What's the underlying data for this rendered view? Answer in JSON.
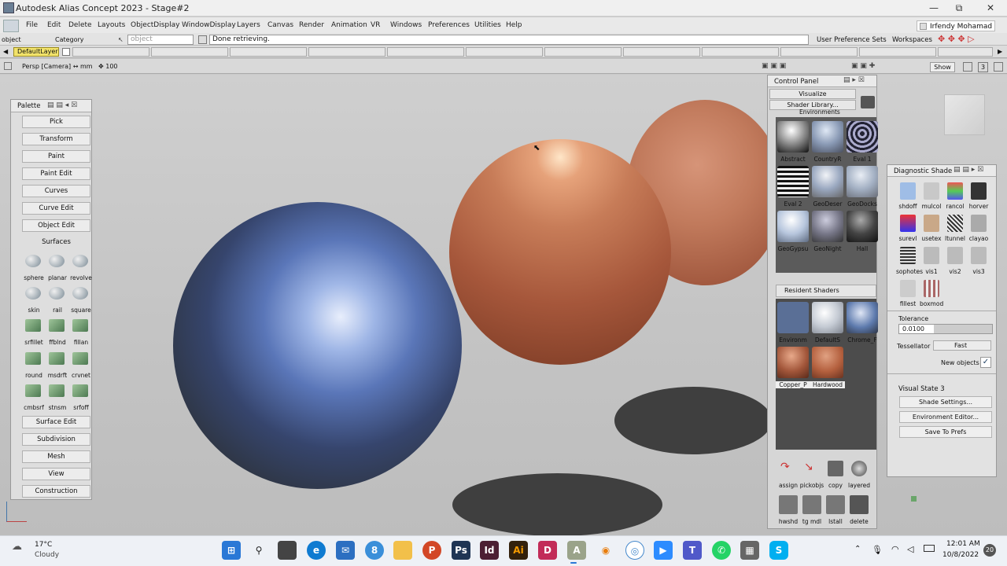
{
  "window": {
    "title": "Autodesk Alias Concept 2023 - Stage#2",
    "minimize": "—",
    "maximize": "⧉",
    "close": "✕"
  },
  "menu": [
    "File",
    "Edit",
    "Delete",
    "Layouts",
    "ObjectDisplay",
    "WindowDisplay",
    "Layers",
    "Canvas",
    "Render",
    "Animation",
    "VR",
    "Windows",
    "Preferences",
    "Utilities",
    "Help"
  ],
  "user": "Irfendy Mohamad",
  "toolrow": {
    "mode": "object",
    "category": "Category",
    "object_placeholder": "object",
    "status": "Done retrieving.",
    "user_pref": "User Preference Sets",
    "workspaces": "Workspaces"
  },
  "layer": {
    "default": "DefaultLayer"
  },
  "viewstrip": {
    "camera": "Persp [Camera] ↔ mm",
    "zoom": "✥ 100",
    "show": "Show",
    "count": "3"
  },
  "palette": {
    "title": "Palette",
    "buttons_top": [
      "Pick",
      "Transform",
      "Paint",
      "Paint Edit",
      "Curves",
      "Curve Edit",
      "Object Edit"
    ],
    "surfaces_label": "Surfaces",
    "tools": [
      "sphere",
      "planar",
      "revolve",
      "skin",
      "rail",
      "square",
      "srfillet",
      "ffblnd",
      "fillan",
      "round",
      "msdrft",
      "crvnet",
      "cmbsrf",
      "stnsm",
      "srfoff"
    ],
    "buttons_bottom": [
      "Surface Edit",
      "Subdivision",
      "Mesh",
      "View",
      "Construction"
    ]
  },
  "control_panel": {
    "title": "Control Panel",
    "visualize": "Visualize",
    "shader_library": "Shader Library...",
    "environments_label": "Environments",
    "environments": [
      "Abstract",
      "CountryR",
      "Eval 1",
      "Eval 2",
      "GeoDeser",
      "GeoDocks",
      "GeoGypsu",
      "GeoNight",
      "Hall"
    ],
    "resident_label": "Resident Shaders",
    "resident": [
      "Environm",
      "DefaultS",
      "Chrome_F",
      "Copper_P",
      "Hardwood"
    ],
    "tools1": [
      "assign",
      "pickobjs",
      "copy",
      "layered"
    ],
    "tools2": [
      "hwshd",
      "tg mdl",
      "lstall",
      "delete"
    ]
  },
  "diagnostic": {
    "title": "Diagnostic Shade",
    "icons": [
      "shdoff",
      "mulcol",
      "rancol",
      "horver",
      "surevl",
      "usetex",
      "ltunnel",
      "clayao",
      "sophotes",
      "vis1",
      "vis2",
      "vis3",
      "fillest",
      "boxmod"
    ],
    "tolerance_label": "Tolerance",
    "tolerance_value": "0.0100",
    "tessellator_label": "Tessellator",
    "tessellator_value": "Fast",
    "new_objects": "New objects",
    "new_objects_checked": "✓",
    "visual_state": "Visual State 3",
    "buttons": [
      "Shade Settings...",
      "Environment Editor...",
      "Save To Prefs"
    ]
  },
  "taskbar": {
    "temp": "17°C",
    "weather": "Cloudy",
    "time": "12:01 AM",
    "date": "10/8/2022",
    "badge": "20"
  },
  "colors": {
    "accent_yellow": "#f2e36a",
    "panel_gray": "#d6d6d6",
    "taskbar": "#eef1f6"
  }
}
